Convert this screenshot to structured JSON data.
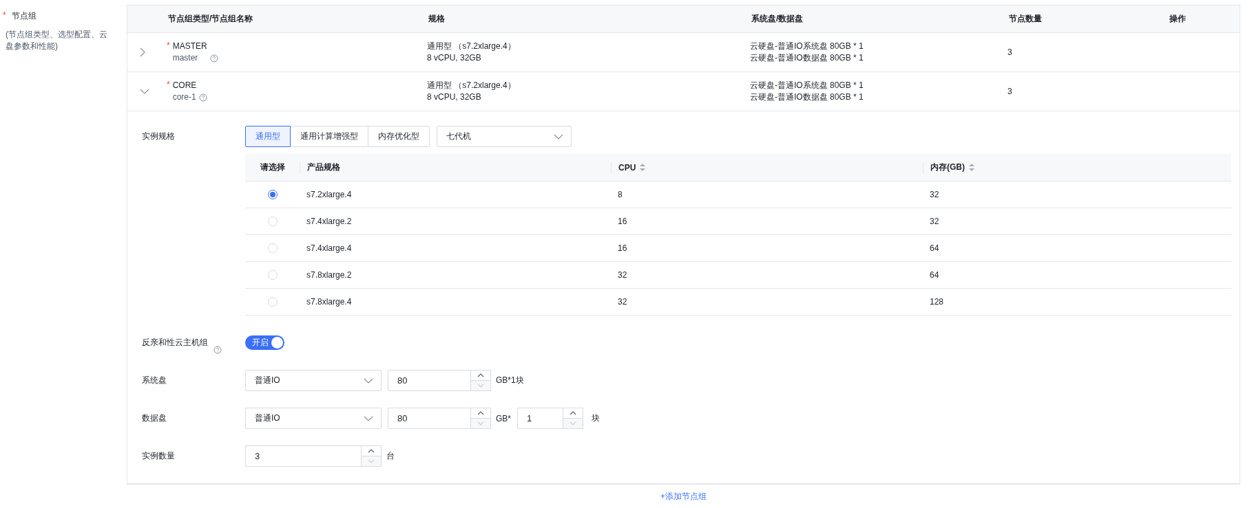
{
  "field": {
    "label": "节点组",
    "required_mark": "*",
    "hint": "(节点组类型、选型配置、云盘参数和性能)"
  },
  "node_table": {
    "columns": [
      "节点组类型/节点组名称",
      "规格",
      "系统盘/数据盘",
      "节点数量",
      "操作"
    ],
    "rows": [
      {
        "expanded": false,
        "required_mark": "*",
        "type": "MASTER",
        "name": "master",
        "spec": [
          "通用型 （s7.2xlarge.4）",
          "8 vCPU, 32GB"
        ],
        "disks": [
          "云硬盘-普通IO系统盘 80GB * 1",
          "云硬盘-普通IO数据盘 80GB * 1"
        ],
        "count": "3"
      },
      {
        "expanded": true,
        "required_mark": "*",
        "type": "CORE",
        "name": "core-1",
        "spec": [
          "通用型 （s7.2xlarge.4）",
          "8 vCPU, 32GB"
        ],
        "disks": [
          "云硬盘-普通IO系统盘 80GB * 1",
          "云硬盘-普通IO数据盘 80GB * 1"
        ],
        "count": "3",
        "detail": {
          "instance_spec": {
            "label": "实例规格",
            "categories": [
              {
                "label": "通用型",
                "selected": true
              },
              {
                "label": "通用计算增强型",
                "selected": false
              },
              {
                "label": "内存优化型",
                "selected": false
              }
            ],
            "generation": "七代机",
            "table": {
              "columns": [
                {
                  "label": "请选择",
                  "sortable": false
                },
                {
                  "label": "产品规格",
                  "sortable": false
                },
                {
                  "label": "CPU",
                  "sortable": true
                },
                {
                  "label": "内存(GB)",
                  "sortable": true
                }
              ],
              "rows": [
                {
                  "selected": true,
                  "spec": "s7.2xlarge.4",
                  "cpu": "8",
                  "memory": "32"
                },
                {
                  "selected": false,
                  "spec": "s7.4xlarge.2",
                  "cpu": "16",
                  "memory": "32"
                },
                {
                  "selected": false,
                  "spec": "s7.4xlarge.4",
                  "cpu": "16",
                  "memory": "64"
                },
                {
                  "selected": false,
                  "spec": "s7.8xlarge.2",
                  "cpu": "32",
                  "memory": "64"
                },
                {
                  "selected": false,
                  "spec": "s7.8xlarge.4",
                  "cpu": "32",
                  "memory": "128"
                }
              ]
            }
          },
          "anti_affinity": {
            "label": "反亲和性云主机组",
            "toggle": {
              "on": true,
              "label": "开启"
            }
          },
          "system_disk": {
            "label": "系统盘",
            "type": "普通IO",
            "size": "80",
            "unit": "GB*1块"
          },
          "data_disk": {
            "label": "数据盘",
            "type": "普通IO",
            "size": "80",
            "unit": "GB*",
            "count": "1",
            "count_unit": "块"
          },
          "instance_count": {
            "label": "实例数量",
            "value": "3",
            "unit": "台"
          }
        }
      }
    ]
  },
  "add_link": "+添加节点组"
}
